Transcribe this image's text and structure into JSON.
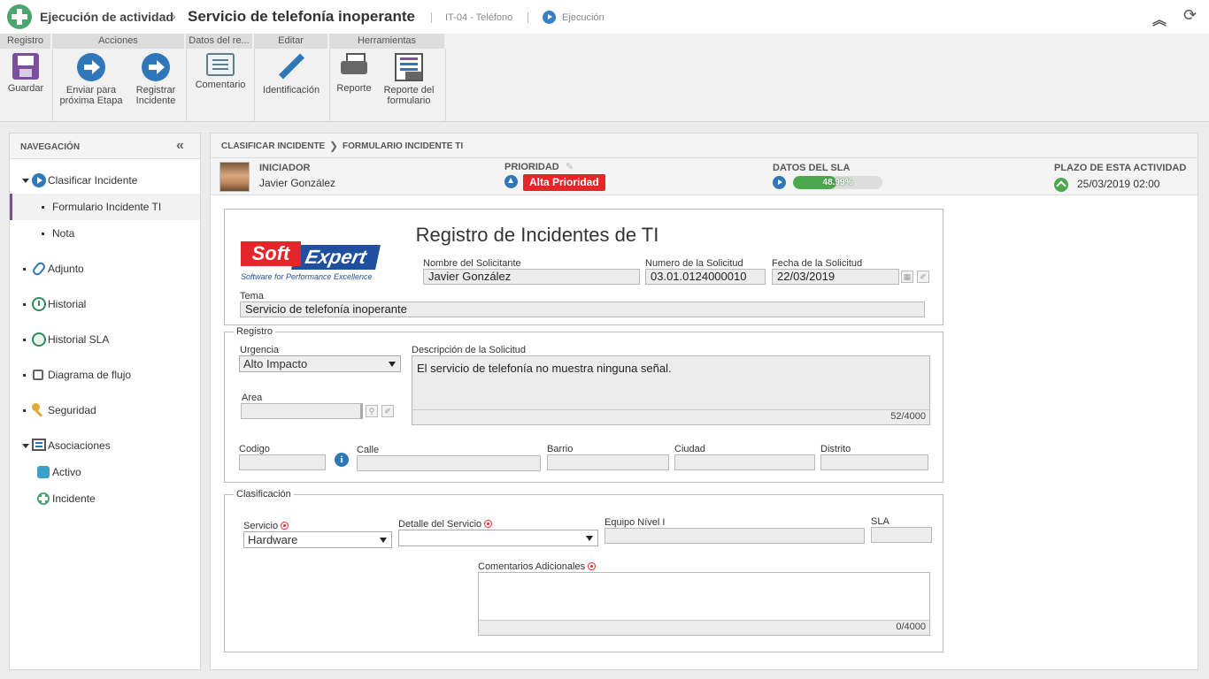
{
  "titlebar": {
    "crumb1": "Ejecución de actividad",
    "crumb2": "Servicio de telefonía inoperante",
    "code": "IT-04 - Teléfono",
    "status": "Ejecución"
  },
  "ribbon": {
    "groups": [
      "Registro",
      "Acciones",
      "Datos del re...",
      "Editar",
      "Herramientas"
    ],
    "buttons": {
      "save": [
        "Guardar"
      ],
      "send": [
        "Enviar para",
        "próxima Etapa"
      ],
      "register": [
        "Registrar",
        "Incidente"
      ],
      "comment": [
        "Comentario"
      ],
      "identify": [
        "Identificación"
      ],
      "report": [
        "Reporte"
      ],
      "form_report": [
        "Reporte del",
        "formulario"
      ]
    }
  },
  "nav": {
    "title": "NAVEGACIÓN",
    "items": [
      {
        "label": "Clasificar Incidente"
      },
      {
        "label": "Formulario Incidente TI"
      },
      {
        "label": "Nota"
      },
      {
        "label": "Adjunto"
      },
      {
        "label": "Historial"
      },
      {
        "label": "Historial SLA"
      },
      {
        "label": "Diagrama de flujo"
      },
      {
        "label": "Seguridad"
      },
      {
        "label": "Asociaciones"
      },
      {
        "label": "Activo"
      },
      {
        "label": "Incidente"
      }
    ]
  },
  "main": {
    "crumb1": "CLASIFICAR INCIDENTE",
    "crumb2": "FORMULARIO INCIDENTE TI",
    "initiator_label": "INICIADOR",
    "initiator": "Javier González",
    "priority_label": "PRIORIDAD",
    "priority": "Alta Prioridad",
    "sla_label": "DATOS DEL SLA",
    "sla_progress": "48.99%",
    "sla_fraction": 0.4899,
    "deadline_label": "PLAZO DE ESTA ACTIVIDAD",
    "deadline": "25/03/2019 02:00"
  },
  "form": {
    "title": "Registro de Incidentes de TI",
    "logo": {
      "part1": "Soft",
      "part2": "Expert",
      "tagline": "Software for Performance Excellence"
    },
    "requester_label": "Nombre del Solicitante",
    "requester": "Javier González",
    "request_no_label": "Numero de la Solicitud",
    "request_no": "03.01.0124000010",
    "request_date_label": "Fecha de la Solicitud",
    "request_date": "22/03/2019",
    "topic_label": "Tema",
    "topic": "Servicio de telefonía inoperante",
    "registro": {
      "legend": "Registro",
      "urgency_label": "Urgencia",
      "urgency": "Alto Impacto",
      "description_label": "Descripción de la Solicitud",
      "description": "El servicio de telefonía no muestra ninguna señal.",
      "description_counter": "52/4000",
      "area_label": "Area",
      "area": "",
      "code_label": "Codigo",
      "street_label": "Calle",
      "neighborhood_label": "Barrio",
      "city_label": "Ciudad",
      "district_label": "Distrito"
    },
    "clasificacion": {
      "legend": "Clasificación",
      "service_label": "Servicio",
      "service": "Hardware",
      "service_detail_label": "Detalle del Servicio",
      "service_detail": "",
      "team_label": "Equipo Nível I",
      "team": "",
      "sla_label": "SLA",
      "sla": "",
      "comments_label": "Comentarios Adicionales",
      "comments": "",
      "comments_counter": "0/4000"
    }
  },
  "colors": {
    "accent": "#2f77b8",
    "purple": "#7b4f9e",
    "danger": "#e8262a",
    "success": "#4ca84f"
  }
}
